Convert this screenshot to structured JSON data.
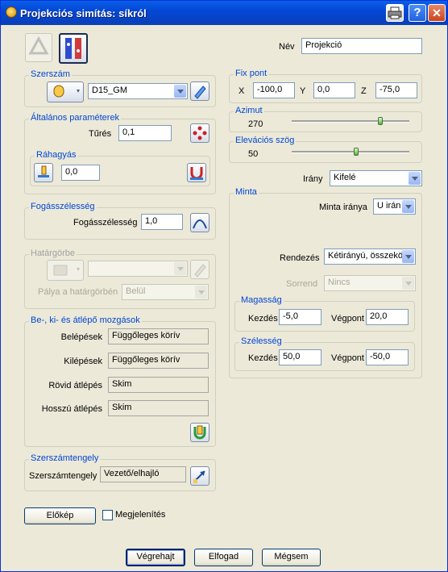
{
  "window": {
    "title": "Projekciós simítás: síkról"
  },
  "top": {
    "nev_label": "Név",
    "nev_value": "Projekció"
  },
  "szerszam": {
    "title": "Szerszám",
    "tool_value": "D15_GM"
  },
  "altalanos": {
    "title": "Általános paraméterek",
    "tures_label": "Tűrés",
    "tures_value": "0,1",
    "rahagyas_title": "Ráhagyás",
    "rahagyas_value": "0,0"
  },
  "fogas": {
    "title": "Fogásszélesség",
    "label": "Fogásszélesség",
    "value": "1,0"
  },
  "hatargorbe": {
    "title": "Határgörbe",
    "palya_label": "Pálya a határgörbén",
    "palya_value": "Belül"
  },
  "mozgasok": {
    "title": "Be-, ki- és átlépő mozgások",
    "rows": [
      {
        "label": "Belépések",
        "value": "Függőleges körív"
      },
      {
        "label": "Kilépések",
        "value": "Függőleges körív"
      },
      {
        "label": "Rövid átlépés",
        "value": "Skim"
      },
      {
        "label": "Hosszú átlépés",
        "value": "Skim"
      }
    ]
  },
  "tengely": {
    "title": "Szerszámtengely",
    "label": "Szerszámtengely",
    "value": "Vezető/elhajló"
  },
  "fixpont": {
    "title": "Fix pont",
    "x_label": "X",
    "x_value": "-100,0",
    "y_label": "Y",
    "y_value": "0,0",
    "z_label": "Z",
    "z_value": "-75,0"
  },
  "azimut": {
    "title": "Azimut",
    "value": "270",
    "slider_fraction": 0.75
  },
  "elevacio": {
    "title": "Elevációs szög",
    "value": "50",
    "slider_fraction": 0.55
  },
  "irany": {
    "label": "Irány",
    "value": "Kifelé"
  },
  "minta": {
    "title": "Minta",
    "irany_label": "Minta iránya",
    "irany_value": "U irán",
    "rendezes_label": "Rendezés",
    "rendezes_value": "Kétirányú, összekö",
    "sorrend_label": "Sorrend",
    "sorrend_value": "Nincs",
    "magassag_title": "Magasság",
    "mag_kezdes_label": "Kezdés",
    "mag_kezdes_value": "-5,0",
    "mag_vegpont_label": "Végpont",
    "mag_vegpont_value": "20,0",
    "szelesseg_title": "Szélesség",
    "sz_kezdes_label": "Kezdés",
    "sz_kezdes_value": "50,0",
    "sz_vegpont_label": "Végpont",
    "sz_vegpont_value": "-50,0"
  },
  "bottom": {
    "elokep": "Előkép",
    "megjelenites": "Megjelenítés",
    "vegrehajt": "Végrehajt",
    "elfogad": "Elfogad",
    "megsem": "Mégsem"
  },
  "colors": {
    "accent": "#0046d5",
    "titlebar": "#0348d6"
  }
}
